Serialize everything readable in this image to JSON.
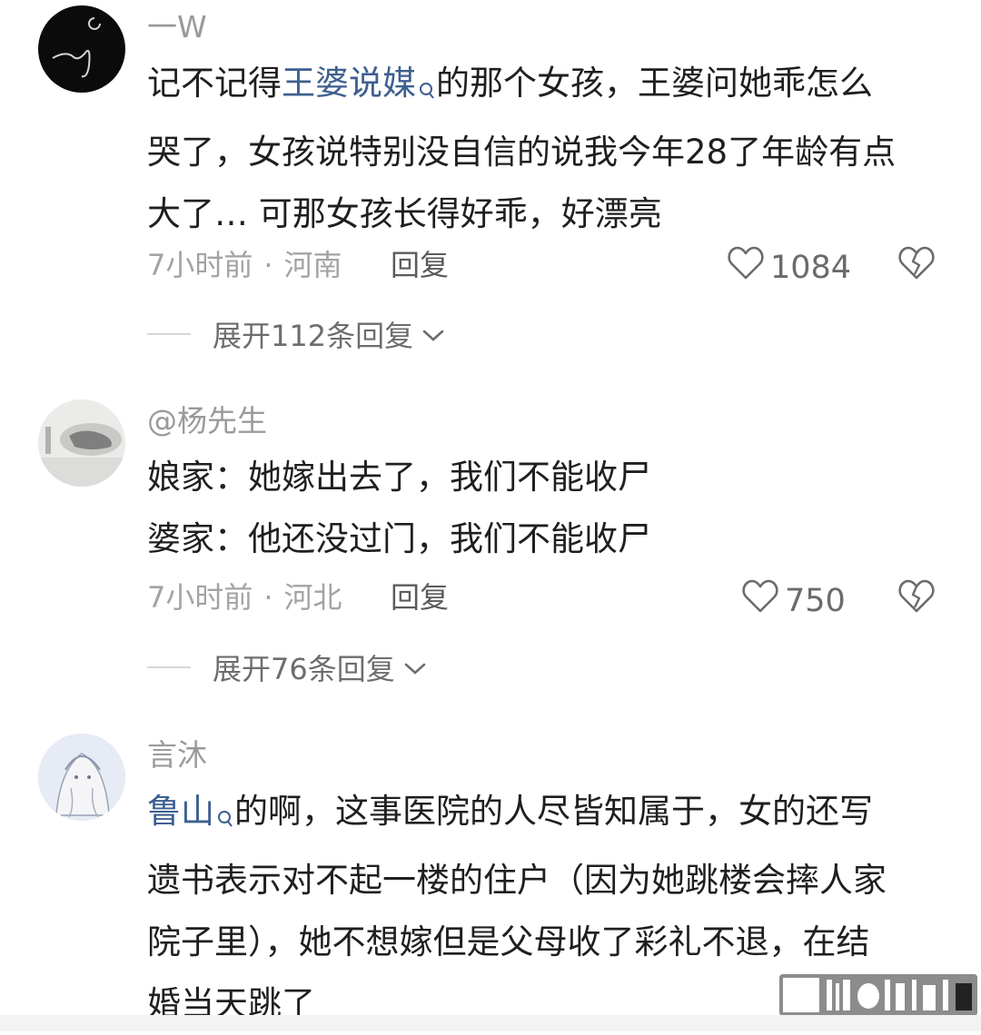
{
  "comments": [
    {
      "username": "一W",
      "lines": [
        {
          "link": "王婆说媒",
          "text_before": "记不记得",
          "text_after": "的那个女孩，王婆问她乖怎么"
        },
        {
          "text": "哭了，女孩说特别没自信的说我今年28了年龄有点"
        },
        {
          "text": "大了… 可那女孩长得好乖，好漂亮"
        }
      ],
      "time": "7小时前",
      "location": "河南",
      "reply_label": "回复",
      "likes": "1084",
      "expand_label": "展开112条回复"
    },
    {
      "username": "@杨先生",
      "lines": [
        {
          "text": "娘家：她嫁出去了，我们不能收尸"
        },
        {
          "text": "婆家：他还没过门，我们不能收尸"
        }
      ],
      "time": "7小时前",
      "location": "河北",
      "reply_label": "回复",
      "likes": "750",
      "expand_label": "展开76条回复"
    },
    {
      "username": "言沐",
      "lines": [
        {
          "link": "鲁山",
          "text_before": "",
          "text_after": "的啊，这事医院的人尽皆知属于，女的还写"
        },
        {
          "text": "遗书表示对不起一楼的住户（因为她跳楼会摔人家"
        },
        {
          "text": "院子里），她不想嫁但是父母收了彩礼不退，在结"
        },
        {
          "text": "婚当天跳了"
        }
      ]
    }
  ],
  "icons": {
    "like": "heart-outline-icon",
    "dislike": "broken-heart-icon",
    "expand": "chevron-down-icon",
    "search": "search-icon"
  },
  "colors": {
    "link": "#3d5f90",
    "meta": "#a3a3a3",
    "username": "#9a9a9a",
    "text": "#1f1f1f"
  }
}
